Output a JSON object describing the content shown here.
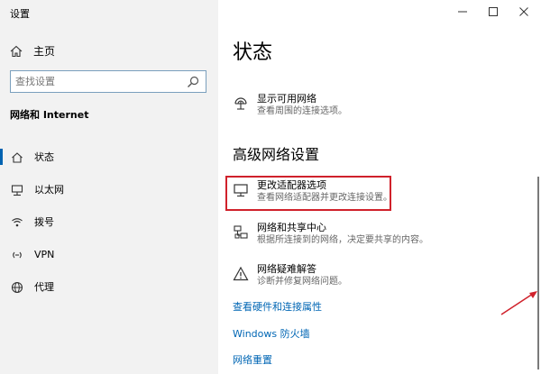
{
  "window": {
    "title": "设置",
    "controls": [
      "minimize",
      "maximize",
      "close"
    ]
  },
  "sidebar": {
    "home_label": "主页",
    "search_placeholder": "查找设置",
    "section_title": "网络和 Internet",
    "items": [
      {
        "label": "状态",
        "icon": "home-status-icon",
        "selected": true
      },
      {
        "label": "以太网",
        "icon": "ethernet-icon",
        "selected": false
      },
      {
        "label": "拨号",
        "icon": "dialup-icon",
        "selected": false
      },
      {
        "label": "VPN",
        "icon": "vpn-icon",
        "selected": false
      },
      {
        "label": "代理",
        "icon": "globe-icon",
        "selected": false
      }
    ]
  },
  "main": {
    "page_title": "状态",
    "top_setting": {
      "title": "显示可用网络",
      "desc": "查看周围的连接选项。"
    },
    "advanced_heading": "高级网络设置",
    "advanced": [
      {
        "title": "更改适配器选项",
        "desc": "查看网络适配器并更改连接设置。",
        "highlighted": true
      },
      {
        "title": "网络和共享中心",
        "desc": "根据所连接到的网络，决定要共享的内容。"
      },
      {
        "title": "网络疑难解答",
        "desc": "诊断并修复网络问题。"
      }
    ],
    "links": [
      "查看硬件和连接属性",
      "Windows 防火墙",
      "网络重置"
    ]
  },
  "colors": {
    "accent": "#0063b1",
    "link": "#0066b4",
    "highlight_box": "#d0212b",
    "sidebar_bg": "#f2f2f2"
  }
}
